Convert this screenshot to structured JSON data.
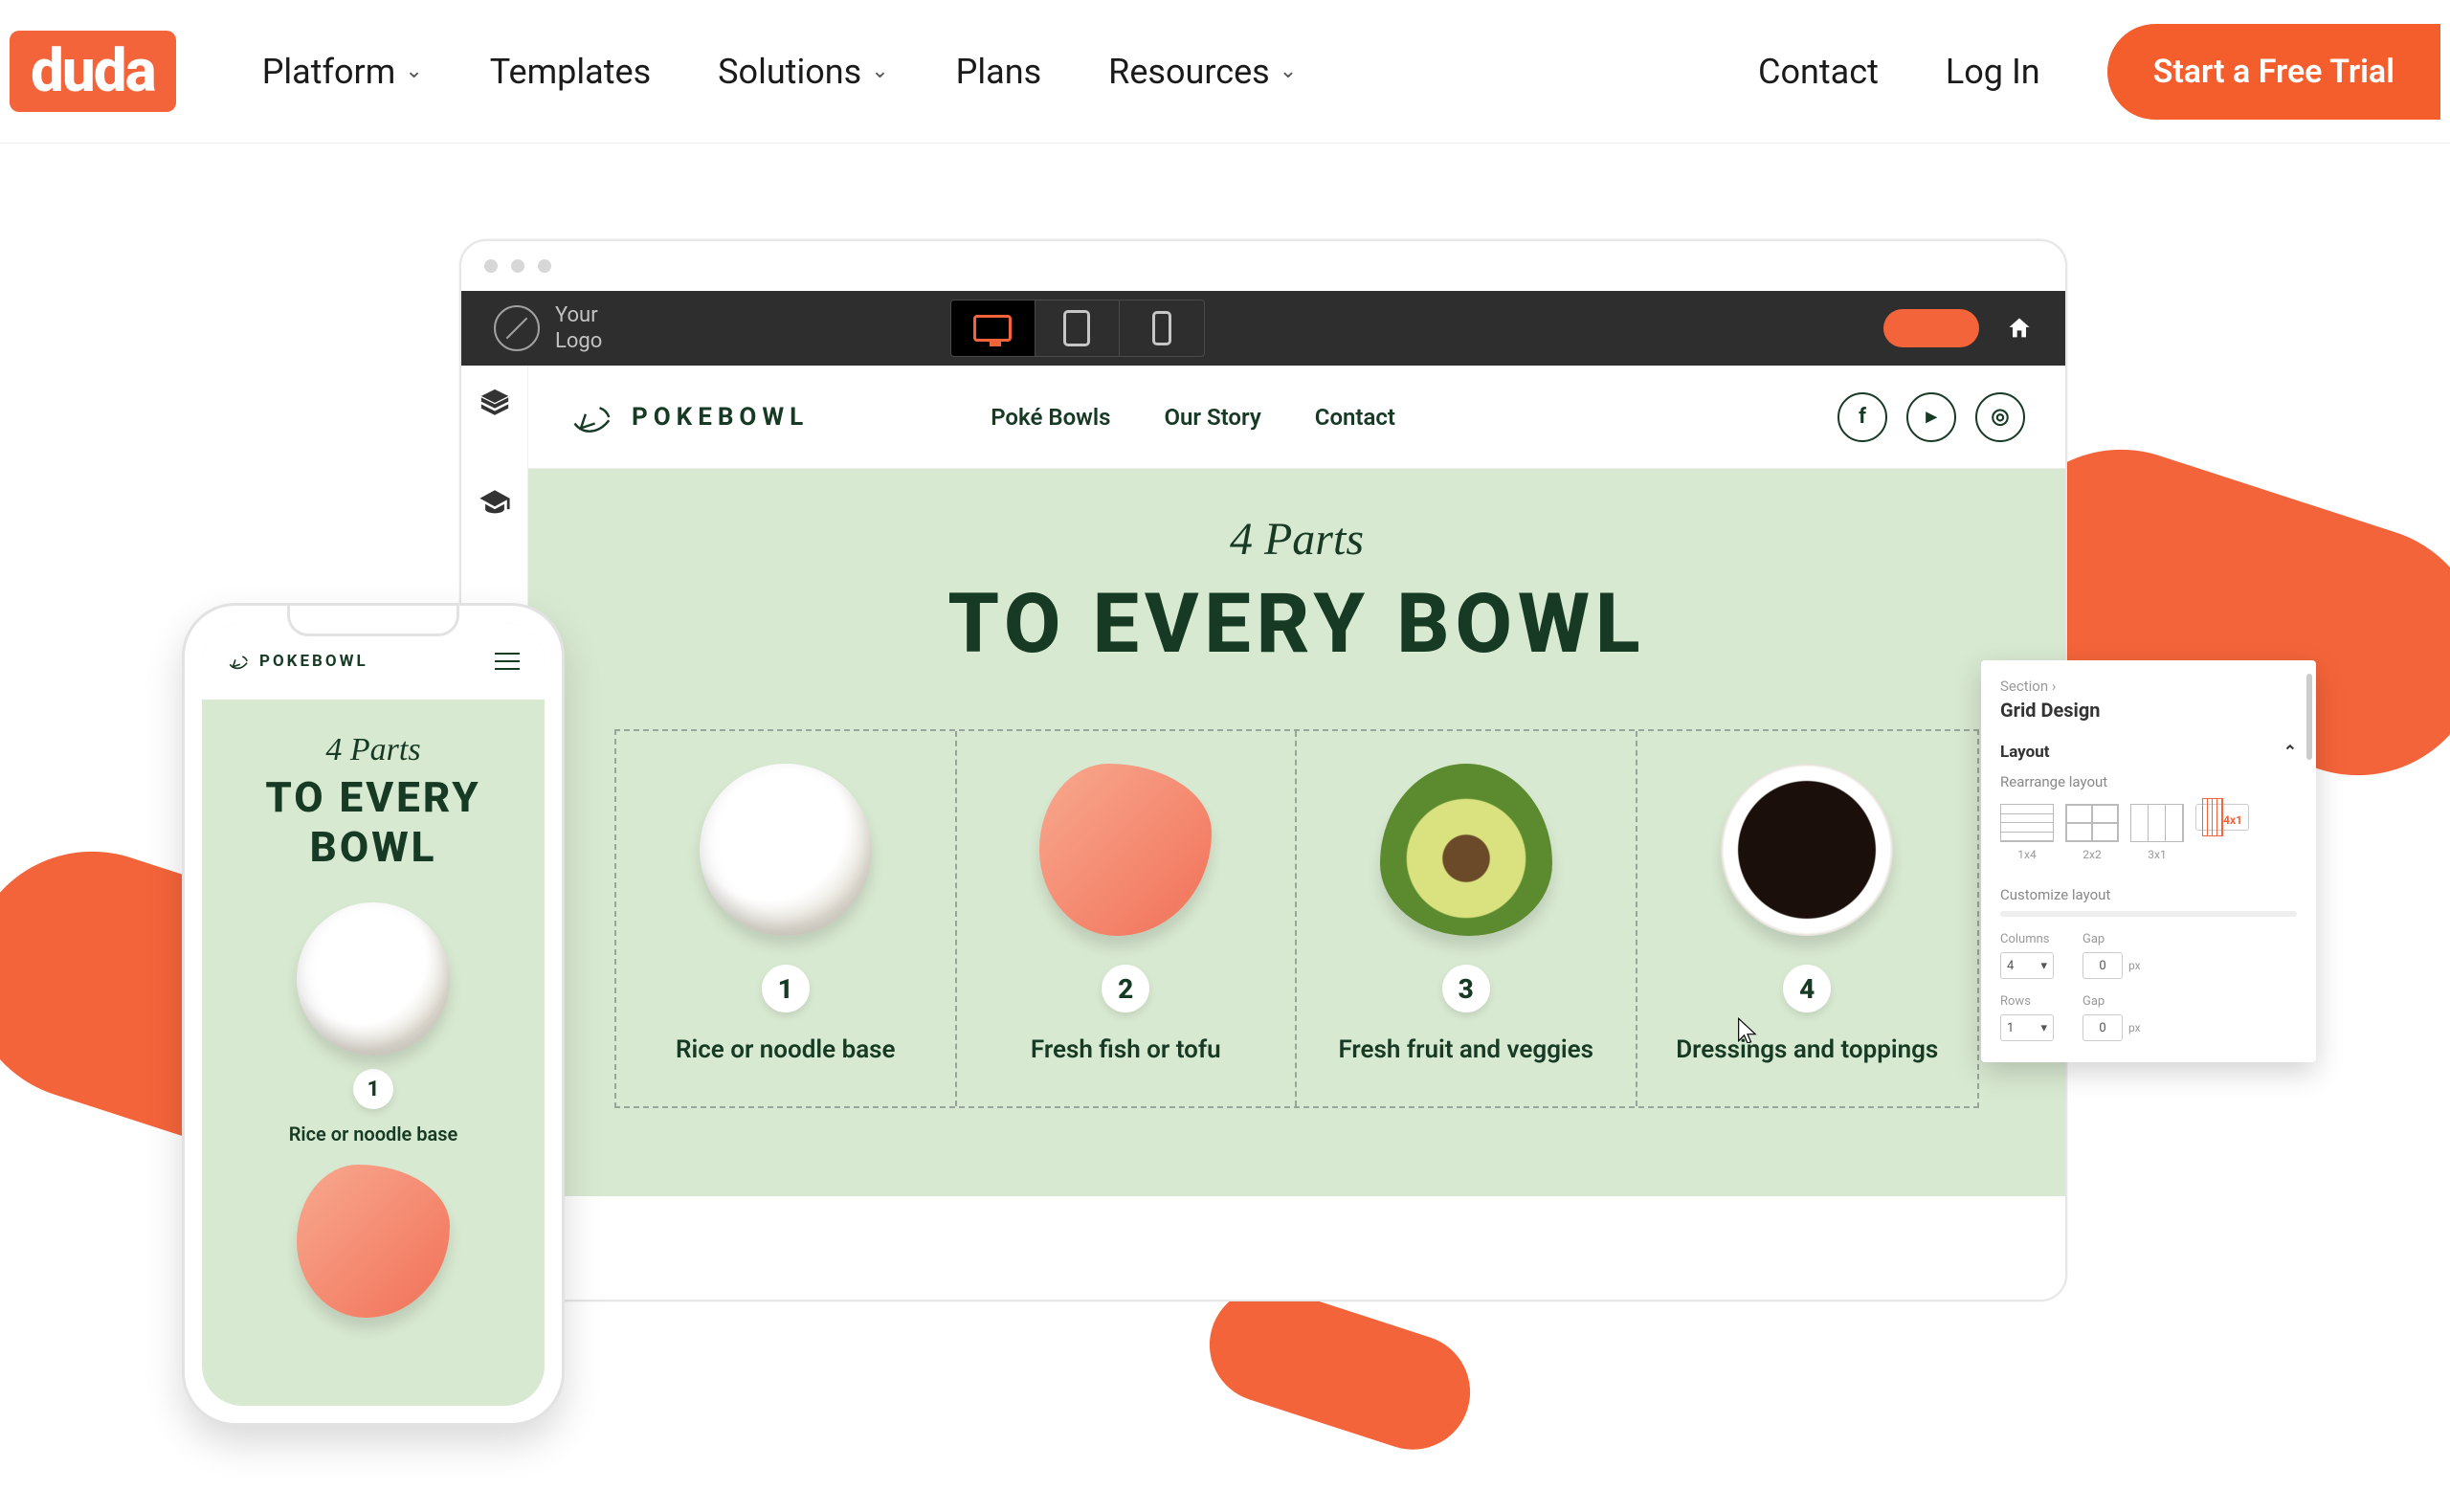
{
  "brand": "duda",
  "nav": {
    "items": [
      "Platform",
      "Templates",
      "Solutions",
      "Plans",
      "Resources"
    ],
    "has_dropdown": [
      true,
      false,
      true,
      false,
      true
    ],
    "contact": "Contact",
    "login": "Log In",
    "cta": "Start a Free Trial"
  },
  "editor": {
    "your_logo_line1": "Your",
    "your_logo_line2": "Logo",
    "devices": [
      "desktop",
      "tablet",
      "phone"
    ],
    "active_device": "desktop"
  },
  "site": {
    "brand": "POKEBOWL",
    "nav": [
      "Poké Bowls",
      "Our Story",
      "Contact"
    ],
    "hero_sup": "4 Parts",
    "hero_title": "TO EVERY BOWL",
    "cards": [
      {
        "num": "1",
        "caption": "Rice or noodle base",
        "img": "rice"
      },
      {
        "num": "2",
        "caption": "Fresh fish or tofu",
        "img": "salmon"
      },
      {
        "num": "3",
        "caption": "Fresh fruit and veggies",
        "img": "avocado"
      },
      {
        "num": "4",
        "caption": "Dressings and toppings",
        "img": "soy"
      }
    ]
  },
  "panel": {
    "crumb": "Section ›",
    "title": "Grid Design",
    "section": "Layout",
    "rearrange": "Rearrange layout",
    "layouts": [
      {
        "id": "1x4",
        "label": "1x4"
      },
      {
        "id": "2x2",
        "label": "2x2"
      },
      {
        "id": "3x1",
        "label": "3x1"
      },
      {
        "id": "4x1",
        "label": "4x1"
      }
    ],
    "selected_layout": "4x1",
    "customize": "Customize layout",
    "columns_label": "Columns",
    "gap_label": "Gap",
    "rows_label": "Rows",
    "columns_value": "4",
    "rows_value": "1",
    "gap_value": "0",
    "gap_unit": "px"
  },
  "phone": {
    "brand": "POKEBOWL",
    "hero_sup": "4 Parts",
    "hero_title": "TO EVERY BOWL",
    "card1_num": "1",
    "card1_caption": "Rice or noodle base"
  }
}
